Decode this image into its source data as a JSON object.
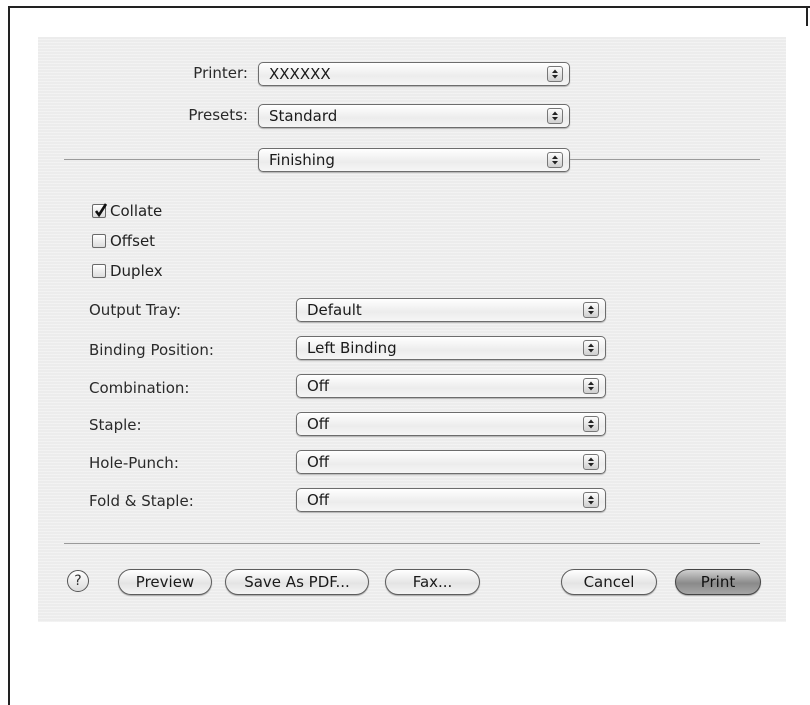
{
  "top": {
    "printer": {
      "label": "Printer:",
      "value": "XXXXXX"
    },
    "presets": {
      "label": "Presets:",
      "value": "Standard"
    },
    "pane": {
      "value": "Finishing"
    }
  },
  "checkboxes": [
    {
      "label": "Collate",
      "checked": true
    },
    {
      "label": "Offset",
      "checked": false
    },
    {
      "label": "Duplex",
      "checked": false
    }
  ],
  "settings": [
    {
      "label": "Output Tray:",
      "value": "Default"
    },
    {
      "label": "Binding Position:",
      "value": "Left Binding"
    },
    {
      "label": "Combination:",
      "value": "Off"
    },
    {
      "label": "Staple:",
      "value": "Off"
    },
    {
      "label": "Hole-Punch:",
      "value": "Off"
    },
    {
      "label": "Fold & Staple:",
      "value": "Off"
    }
  ],
  "buttons": {
    "help": "?",
    "preview": "Preview",
    "save_pdf": "Save As PDF...",
    "fax": "Fax...",
    "cancel": "Cancel",
    "print": "Print"
  }
}
